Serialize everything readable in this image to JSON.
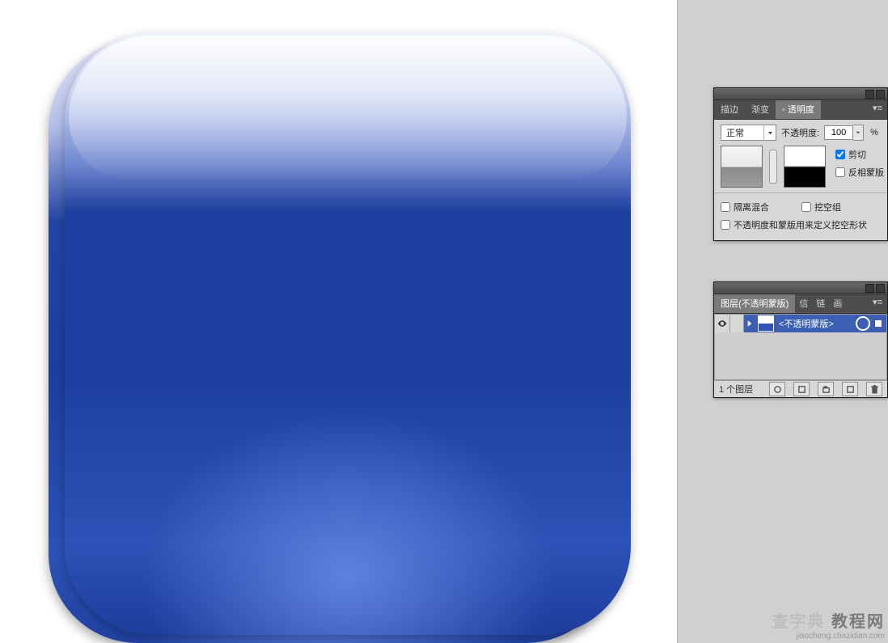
{
  "transparency_panel": {
    "tabs": {
      "stroke": "描边",
      "gradient": "渐变",
      "transparency": "透明度"
    },
    "blend_mode_label": "正常",
    "opacity_label": "不透明度:",
    "opacity_value": "100",
    "opacity_suffix": "%",
    "clip_label": "剪切",
    "invert_mask_label": "反相蒙版",
    "clip_checked": true,
    "invert_mask_checked": false,
    "isolate_label": "隔离混合",
    "knockout_label": "挖空组",
    "isolate_checked": false,
    "knockout_checked": false,
    "opacity_mask_shape_label": "不透明度和蒙版用来定义挖空形状",
    "opacity_mask_shape_checked": false
  },
  "layers_panel": {
    "tabs": {
      "layers": "图层(不透明蒙版)",
      "info": "信",
      "links": "链",
      "art": "画"
    },
    "layer_name": "<不透明蒙版>",
    "count_label": "1 个图层"
  },
  "watermark": {
    "brand_a": "查字典",
    "brand_b": "教程网",
    "url": "jiaocheng.chazidian.com"
  }
}
